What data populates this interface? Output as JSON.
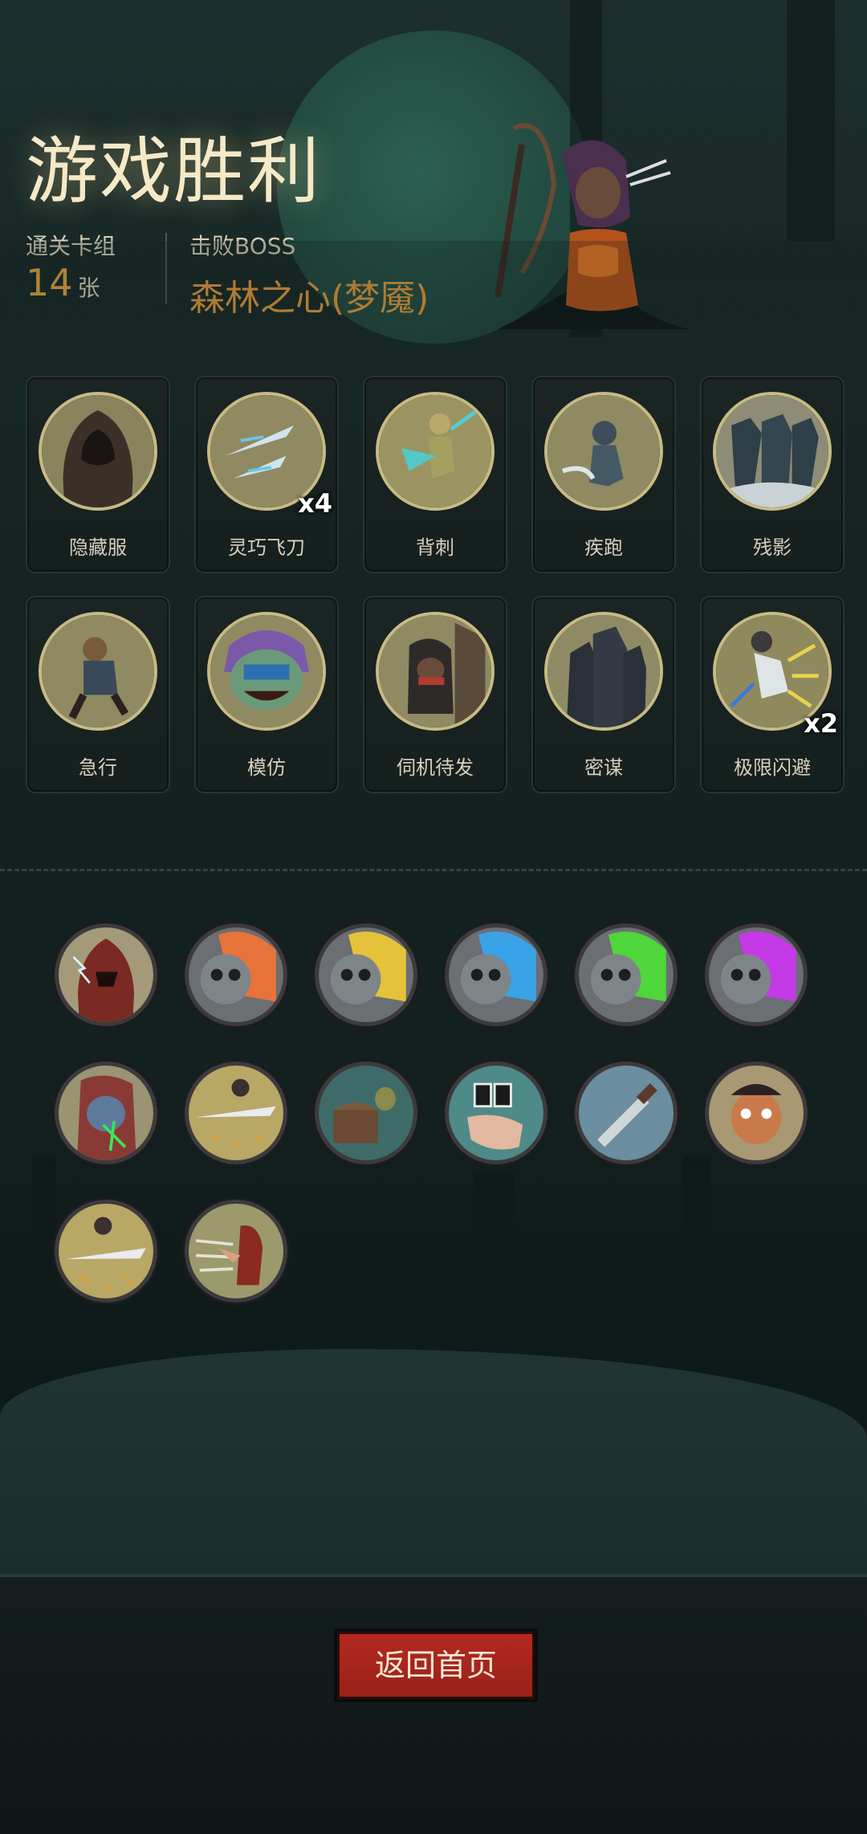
{
  "header": {
    "title": "游戏胜利",
    "deck_label": "通关卡组",
    "deck_count": "14",
    "deck_unit": "张",
    "boss_label": "击败BOSS",
    "boss_name": "森林之心(梦魇)"
  },
  "cards": [
    {
      "name": "隐藏服",
      "multiplier": "",
      "icon": "hooded-cloak-icon"
    },
    {
      "name": "灵巧飞刀",
      "multiplier": "x4",
      "icon": "flying-daggers-icon"
    },
    {
      "name": "背刺",
      "multiplier": "",
      "icon": "backstab-icon"
    },
    {
      "name": "疾跑",
      "multiplier": "",
      "icon": "sprint-icon"
    },
    {
      "name": "残影",
      "multiplier": "",
      "icon": "afterimage-icon"
    },
    {
      "name": "急行",
      "multiplier": "",
      "icon": "dash-icon"
    },
    {
      "name": "模仿",
      "multiplier": "",
      "icon": "mimic-icon"
    },
    {
      "name": "伺机待发",
      "multiplier": "",
      "icon": "ambush-icon"
    },
    {
      "name": "密谋",
      "multiplier": "",
      "icon": "conspiracy-icon"
    },
    {
      "name": "极限闪避",
      "multiplier": "x2",
      "icon": "extreme-dodge-icon"
    }
  ],
  "relics": [
    {
      "icon": "red-hood-lightning-icon",
      "color": "#7a2a22"
    },
    {
      "icon": "skull-orange-flame-icon",
      "color": "#e8733a"
    },
    {
      "icon": "skull-yellow-flame-icon",
      "color": "#e6c23a"
    },
    {
      "icon": "skull-blue-flame-icon",
      "color": "#3aa2e6"
    },
    {
      "icon": "skull-green-flame-icon",
      "color": "#4ed63a"
    },
    {
      "icon": "skull-purple-flame-icon",
      "color": "#c43ae6"
    },
    {
      "icon": "goblin-poison-icon",
      "color": "#8a3a34"
    },
    {
      "icon": "thrown-blade-icon",
      "color": "#b9a766"
    },
    {
      "icon": "treasure-chest-icon",
      "color": "#3e6b6a"
    },
    {
      "icon": "glove-cards-icon",
      "color": "#4e8a88"
    },
    {
      "icon": "knife-icon",
      "color": "#6b8ea0"
    },
    {
      "icon": "pirate-icon",
      "color": "#a89874"
    },
    {
      "icon": "gold-blade-icon",
      "color": "#b9a766"
    },
    {
      "icon": "red-hood-dash-icon",
      "color": "#9c9a6c"
    }
  ],
  "footer": {
    "return_label": "返回首页"
  }
}
